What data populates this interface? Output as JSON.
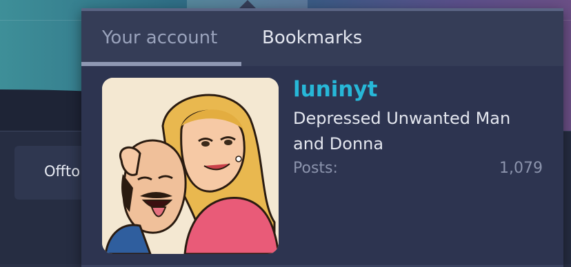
{
  "background": {
    "chip_label": "Offto"
  },
  "popup": {
    "tabs": [
      {
        "label": "Your account",
        "active": true
      },
      {
        "label": "Bookmarks",
        "active": false
      }
    ],
    "profile": {
      "username": "luninyt",
      "title_line1": "Depressed Unwanted Man",
      "title_line2": "and Donna",
      "stats": [
        {
          "label": "Posts:",
          "value": "1,079"
        }
      ]
    }
  },
  "colors": {
    "username": "#27b7d7",
    "popup_bg": "#2d3450",
    "tab_bg": "#353d57"
  }
}
